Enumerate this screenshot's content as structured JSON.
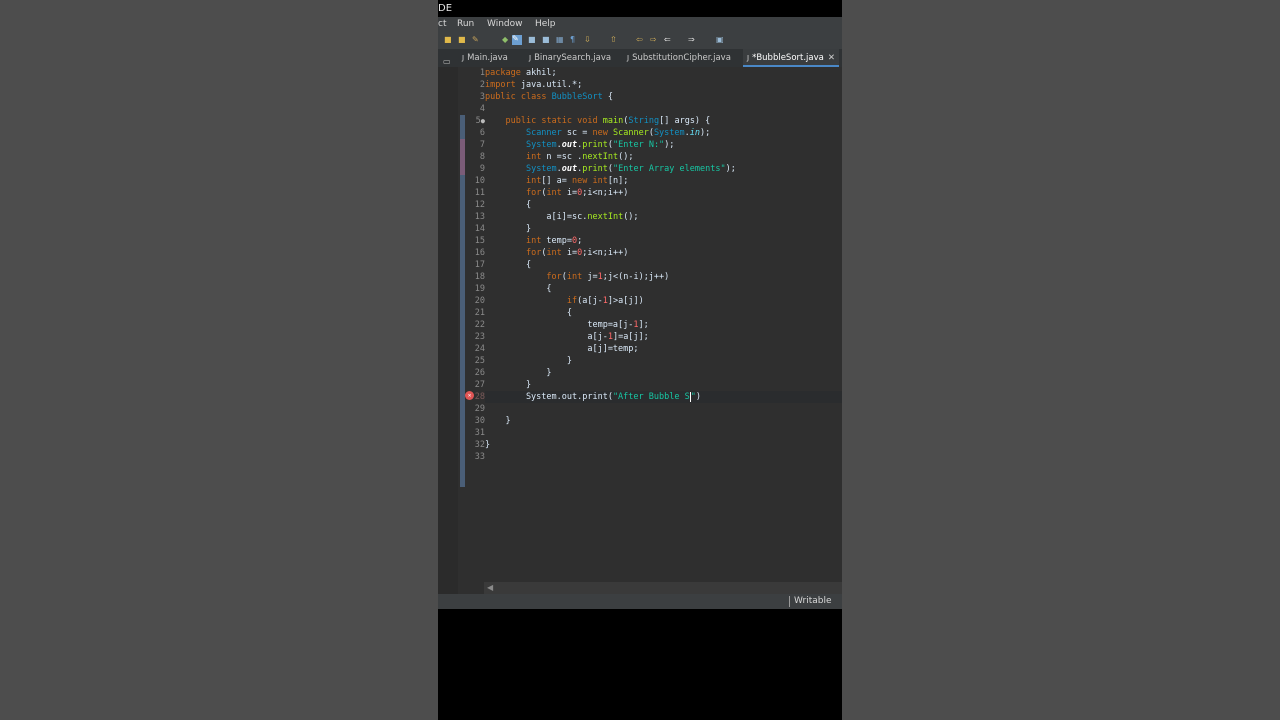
{
  "window": {
    "title": "DE"
  },
  "menu": {
    "items": [
      "ct",
      "Run",
      "Window",
      "Help"
    ]
  },
  "tabs": [
    {
      "label": "Main.java",
      "active": false
    },
    {
      "label": "BinarySearch.java",
      "active": false
    },
    {
      "label": "SubstitutionCipher.java",
      "active": false
    },
    {
      "label": "*BubbleSort.java",
      "active": true
    }
  ],
  "editor": {
    "line_numbers": [
      "1",
      "2",
      "3",
      "4",
      "5",
      "6",
      "7",
      "8",
      "9",
      "10",
      "11",
      "12",
      "13",
      "14",
      "15",
      "16",
      "17",
      "18",
      "19",
      "20",
      "21",
      "22",
      "23",
      "24",
      "25",
      "26",
      "27",
      "28",
      "29",
      "30",
      "31",
      "32",
      "33"
    ],
    "current_line": "28"
  },
  "status": {
    "mode": "Writable"
  },
  "colors": {
    "keyword": "#cc6c1d",
    "type": "#1290c3",
    "string": "#17c6a3",
    "method": "#a7ec21",
    "field": "#8dda8d",
    "plain": "#d9e8f7"
  },
  "code_tokens": {
    "l1a": "package",
    "l1b": " akhil;",
    "l2a": "import",
    "l2b": " java.util.*;",
    "l3a": "public",
    "l3b": " ",
    "l3c": "class",
    "l3d": " ",
    "l3e": "BubbleSort",
    "l3f": " {",
    "l5a": "    ",
    "l5b": "public",
    "l5c": " ",
    "l5d": "static",
    "l5e": " ",
    "l5f": "void",
    "l5g": " ",
    "l5h": "main",
    "l5i": "(",
    "l5j": "String",
    "l5k": "[] args) {",
    "l6a": "        ",
    "l6b": "Scanner",
    "l6c": " sc = ",
    "l6d": "new",
    "l6e": " ",
    "l6f": "Scanner",
    "l6g": "(",
    "l6h": "System",
    "l6i": ".",
    "l6j": "in",
    "l6k": ");",
    "l7a": "        ",
    "l7b": "System",
    "l7c": ".",
    "l7d": "out",
    "l7e": ".",
    "l7f": "print",
    "l7g": "(",
    "l7h": "\"Enter N:\"",
    "l7i": ");",
    "l8a": "        ",
    "l8b": "int",
    "l8c": " n =sc .",
    "l8d": "nextInt",
    "l8e": "();",
    "l9a": "        ",
    "l9b": "System",
    "l9c": ".",
    "l9d": "out",
    "l9e": ".",
    "l9f": "print",
    "l9g": "(",
    "l9h": "\"Enter Array elements\"",
    "l9i": ");",
    "l10a": "        ",
    "l10b": "int",
    "l10c": "[] a= ",
    "l10d": "new",
    "l10e": " ",
    "l10f": "int",
    "l10g": "[n];",
    "l11a": "        ",
    "l11b": "for",
    "l11c": "(",
    "l11d": "int",
    "l11e": " i=",
    "l11f": "0",
    "l11g": ";i<n;i++)",
    "l12a": "        {",
    "l13a": "            a[i]=sc.",
    "l13b": "nextInt",
    "l13c": "();",
    "l14a": "        }",
    "l15a": "        ",
    "l15b": "int",
    "l15c": " temp=",
    "l15d": "0",
    "l15e": ";",
    "l16a": "        ",
    "l16b": "for",
    "l16c": "(",
    "l16d": "int",
    "l16e": " i=",
    "l16f": "0",
    "l16g": ";i<n;i++)",
    "l17a": "        {",
    "l18a": "            ",
    "l18b": "for",
    "l18c": "(",
    "l18d": "int",
    "l18e": " j=",
    "l18f": "1",
    "l18g": ";j<(n-i);j++)",
    "l19a": "            {",
    "l20a": "                ",
    "l20b": "if",
    "l20c": "(a[j-",
    "l20d": "1",
    "l20e": "]>a[j])",
    "l21a": "                {",
    "l22a": "                    temp=a[j-",
    "l22b": "1",
    "l22c": "];",
    "l23a": "                    a[j-",
    "l23b": "1",
    "l23c": "]=a[j];",
    "l24a": "                    a[j]=temp;",
    "l25a": "                }",
    "l26a": "            }",
    "l27a": "        }",
    "l28a": "        System.out.print(",
    "l28b": "\"After Bubble S",
    "l28c": "\"",
    "l28d": ")",
    "l30a": "    }",
    "l32a": "}"
  }
}
